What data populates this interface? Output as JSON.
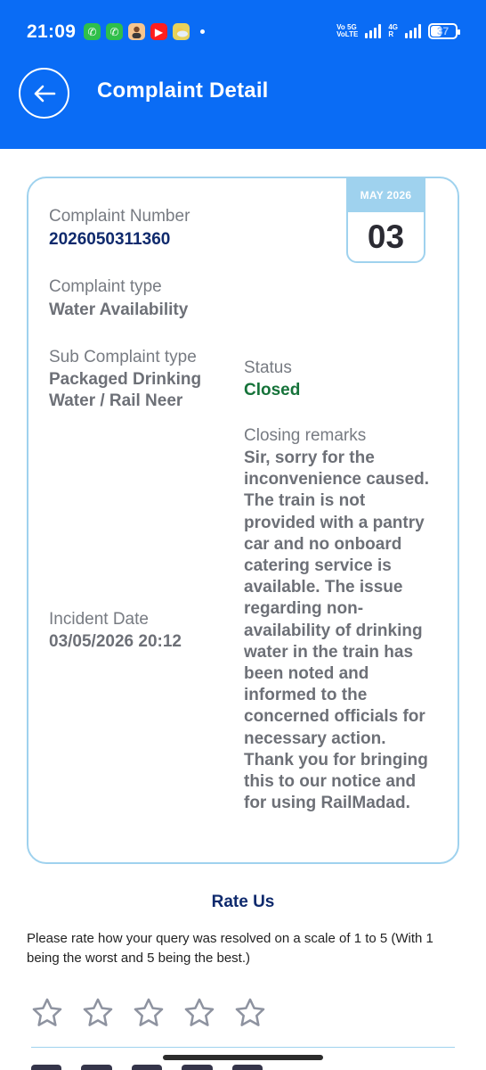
{
  "status_bar": {
    "time": "21:09",
    "net_line1": "Vo 5G",
    "net_line2": "VoLTE",
    "net_line3": "4G",
    "net_line4": "R",
    "battery": "37",
    "notification_icons": [
      "whatsapp-icon",
      "whatsapp-icon",
      "avatar-icon",
      "youtube-icon",
      "weather-icon"
    ]
  },
  "header": {
    "title": "Complaint Detail",
    "back_icon": "arrow-left-icon",
    "background": "#0a6cf5"
  },
  "complaint": {
    "date_month": "MAY 2026",
    "date_day": "03",
    "number_label": "Complaint Number",
    "number": "2026050311360",
    "type_label": "Complaint type",
    "type": "Water Availability",
    "sub_type_label": "Sub Complaint type",
    "sub_type_line1": "Packaged Drinking",
    "sub_type_line2": "Water / Rail Neer",
    "status_label": "Status",
    "status": "Closed",
    "remarks_label": "Closing remarks",
    "remarks": "Sir, sorry for the inconvenience caused. The train is not provided with a pantry car and no onboard catering service is available. The issue regarding non-availability of drinking water in the train has been noted and informed to the concerned officials for necessary action. Thank you for bringing this to our notice and for using RailMadad.",
    "incident_label": "Incident Date",
    "incident_date": "03/05/2026 20:12"
  },
  "rating": {
    "title": "Rate Us",
    "description": "Please rate how your query was resolved on a scale of 1 to 5 (With 1 being the worst and 5 being the best.)",
    "max_stars": 5,
    "selected": 0
  },
  "colors": {
    "accent": "#0a6cf5",
    "card_border": "#9fd2ee",
    "dark_blue_text": "#0f2a6d",
    "status_closed": "#16733a"
  }
}
